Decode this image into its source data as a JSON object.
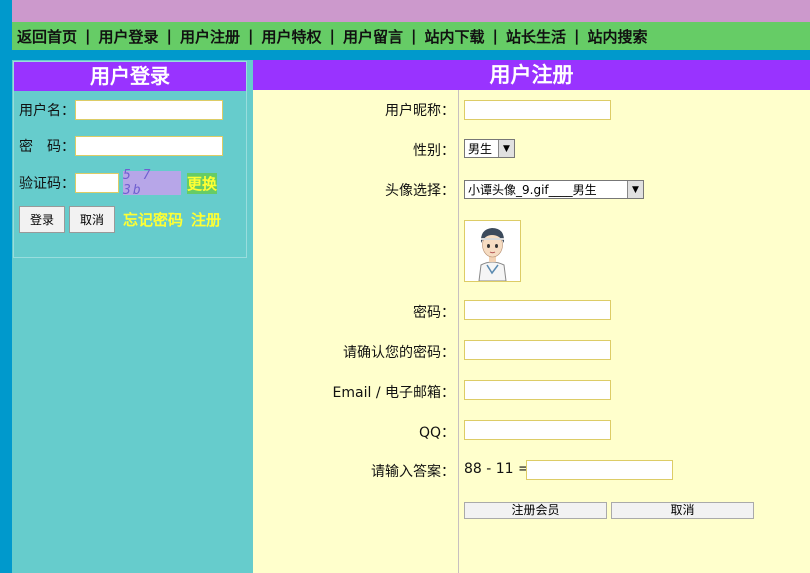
{
  "nav": {
    "items": [
      "返回首页",
      "用户登录",
      "用户注册",
      "用户特权",
      "用户留言",
      "站内下载",
      "站长生活",
      "站内搜索"
    ],
    "separator": "|"
  },
  "login": {
    "title": "用户登录",
    "username_label": "用户名：",
    "password_label": "密　码：",
    "captcha_label": "验证码：",
    "captcha_text": "5 7 3b",
    "refresh_label": "更换",
    "login_button": "登录",
    "cancel_button": "取消",
    "forgot_link": "忘记密码",
    "register_link": "注册"
  },
  "register": {
    "title": "用户注册",
    "nickname_label": "用户昵称：",
    "gender_label": "性别：",
    "gender_value": "男生",
    "avatar_label": "头像选择：",
    "avatar_value": "小谭头像_9.gif____男生",
    "password_label": "密码：",
    "confirm_label": "请确认您的密码：",
    "email_label": "Email / 电子邮箱：",
    "qq_label": "QQ：",
    "answer_label": "请输入答案：",
    "question": "88 - 11 =",
    "submit_button": "注册会员",
    "cancel_button": "取消"
  },
  "colors": {
    "brand_purple": "#9933ff",
    "nav_green": "#66cc66",
    "stripe_blue": "#0099cc",
    "panel_teal": "#66cccc",
    "form_yellow": "#ffffcc",
    "link_yellow": "#ffff33"
  }
}
